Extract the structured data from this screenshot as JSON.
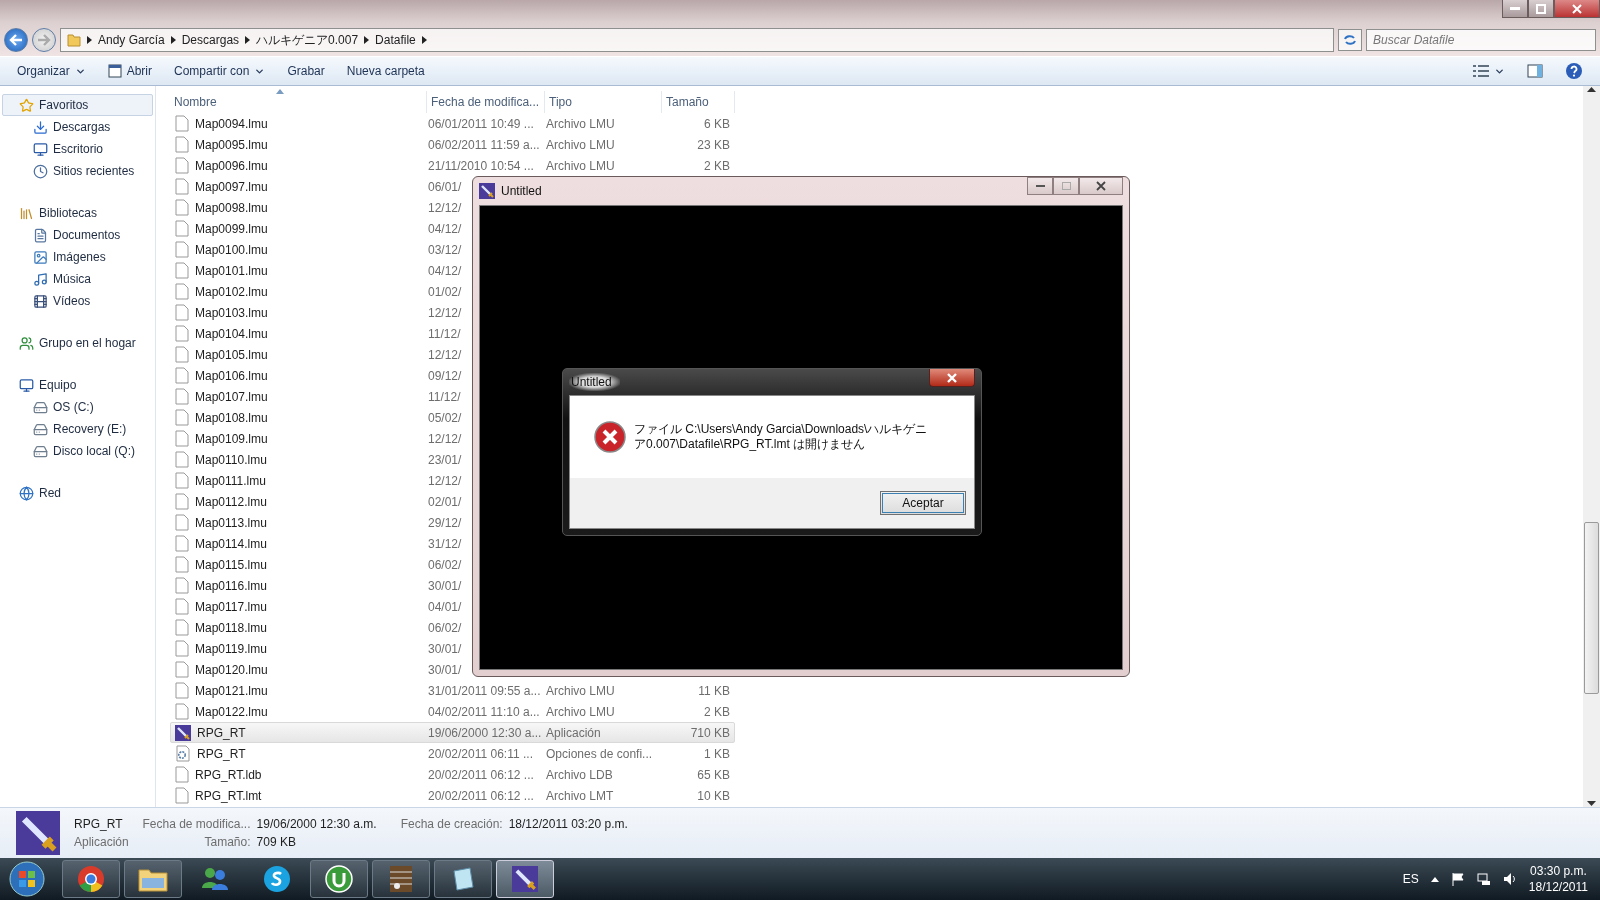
{
  "window": {
    "breadcrumb": [
      "Andy García",
      "Descargas",
      "ハルキゲニア0.007",
      "Datafile"
    ],
    "search": {
      "placeholder": "Buscar Datafile"
    }
  },
  "toolbar": [
    {
      "label": "Organizar",
      "has_menu": true,
      "kind": "text"
    },
    {
      "label": "Abrir",
      "has_menu": false,
      "kind": "open"
    },
    {
      "label": "Compartir con",
      "has_menu": true,
      "kind": "text"
    },
    {
      "label": "Grabar",
      "has_menu": false,
      "kind": "text"
    },
    {
      "label": "Nueva carpeta",
      "has_menu": false,
      "kind": "text"
    }
  ],
  "sidebar": [
    {
      "label": "Favoritos",
      "kind": "favorites",
      "selected": true,
      "children": [
        {
          "label": "Descargas",
          "kind": "downloads",
          "selected": false
        },
        {
          "label": "Escritorio",
          "kind": "desktop",
          "selected": false
        },
        {
          "label": "Sitios recientes",
          "kind": "recent",
          "selected": false
        }
      ]
    },
    {
      "label": "Bibliotecas",
      "kind": "libraries",
      "selected": false,
      "children": [
        {
          "label": "Documentos",
          "kind": "documents",
          "selected": false
        },
        {
          "label": "Imágenes",
          "kind": "pictures",
          "selected": false
        },
        {
          "label": "Música",
          "kind": "music",
          "selected": false
        },
        {
          "label": "Vídeos",
          "kind": "videos",
          "selected": false
        }
      ]
    },
    {
      "label": "Grupo en el hogar",
      "kind": "homegroup",
      "selected": false
    },
    {
      "label": "Equipo",
      "kind": "computer",
      "selected": false,
      "children": [
        {
          "label": "OS (C:)",
          "kind": "system-drive",
          "selected": false
        },
        {
          "label": "Recovery (E:)",
          "kind": "drive",
          "selected": false
        },
        {
          "label": "Disco local (Q:)",
          "kind": "drive",
          "selected": false
        }
      ]
    },
    {
      "label": "Red",
      "kind": "network",
      "selected": false
    }
  ],
  "table": {
    "columns": [
      {
        "label": "Nombre",
        "sorted": true
      },
      {
        "label": "Fecha de modifica..."
      },
      {
        "label": "Tipo"
      },
      {
        "label": "Tamaño"
      }
    ],
    "rows": [
      {
        "name": "Map0094.lmu",
        "kind": "file",
        "selected": false,
        "date": "06/01/2011 10:49 ...",
        "type": "Archivo LMU",
        "size": "6 KB"
      },
      {
        "name": "Map0095.lmu",
        "kind": "file",
        "selected": false,
        "date": "06/02/2011 11:59 a...",
        "type": "Archivo LMU",
        "size": "23 KB"
      },
      {
        "name": "Map0096.lmu",
        "kind": "file",
        "selected": false,
        "date": "21/11/2010 10:54 ...",
        "type": "Archivo LMU",
        "size": "2 KB"
      },
      {
        "name": "Map0097.lmu",
        "kind": "file",
        "selected": false,
        "date": "06/01/"
      },
      {
        "name": "Map0098.lmu",
        "kind": "file",
        "selected": false,
        "date": "12/12/"
      },
      {
        "name": "Map0099.lmu",
        "kind": "file",
        "selected": false,
        "date": "04/12/"
      },
      {
        "name": "Map0100.lmu",
        "kind": "file",
        "selected": false,
        "date": "03/12/"
      },
      {
        "name": "Map0101.lmu",
        "kind": "file",
        "selected": false,
        "date": "04/12/"
      },
      {
        "name": "Map0102.lmu",
        "kind": "file",
        "selected": false,
        "date": "01/02/"
      },
      {
        "name": "Map0103.lmu",
        "kind": "file",
        "selected": false,
        "date": "12/12/"
      },
      {
        "name": "Map0104.lmu",
        "kind": "file",
        "selected": false,
        "date": "11/12/"
      },
      {
        "name": "Map0105.lmu",
        "kind": "file",
        "selected": false,
        "date": "12/12/"
      },
      {
        "name": "Map0106.lmu",
        "kind": "file",
        "selected": false,
        "date": "09/12/"
      },
      {
        "name": "Map0107.lmu",
        "kind": "file",
        "selected": false,
        "date": "11/12/"
      },
      {
        "name": "Map0108.lmu",
        "kind": "file",
        "selected": false,
        "date": "05/02/"
      },
      {
        "name": "Map0109.lmu",
        "kind": "file",
        "selected": false,
        "date": "12/12/"
      },
      {
        "name": "Map0110.lmu",
        "kind": "file",
        "selected": false,
        "date": "23/01/"
      },
      {
        "name": "Map0111.lmu",
        "kind": "file",
        "selected": false,
        "date": "12/12/"
      },
      {
        "name": "Map0112.lmu",
        "kind": "file",
        "selected": false,
        "date": "02/01/"
      },
      {
        "name": "Map0113.lmu",
        "kind": "file",
        "selected": false,
        "date": "29/12/"
      },
      {
        "name": "Map0114.lmu",
        "kind": "file",
        "selected": false,
        "date": "31/12/"
      },
      {
        "name": "Map0115.lmu",
        "kind": "file",
        "selected": false,
        "date": "06/02/"
      },
      {
        "name": "Map0116.lmu",
        "kind": "file",
        "selected": false,
        "date": "30/01/"
      },
      {
        "name": "Map0117.lmu",
        "kind": "file",
        "selected": false,
        "date": "04/01/"
      },
      {
        "name": "Map0118.lmu",
        "kind": "file",
        "selected": false,
        "date": "06/02/"
      },
      {
        "name": "Map0119.lmu",
        "kind": "file",
        "selected": false,
        "date": "30/01/"
      },
      {
        "name": "Map0120.lmu",
        "kind": "file",
        "selected": false,
        "date": "30/01/"
      },
      {
        "name": "Map0121.lmu",
        "kind": "file",
        "selected": false,
        "date": "31/01/2011 09:55 a...",
        "type": "Archivo LMU",
        "size": "11 KB"
      },
      {
        "name": "Map0122.lmu",
        "kind": "file",
        "selected": false,
        "date": "04/02/2011 11:10 a...",
        "type": "Archivo LMU",
        "size": "2 KB"
      },
      {
        "name": "RPG_RT",
        "kind": "app",
        "selected": true,
        "date": "19/06/2000 12:30 a...",
        "type": "Aplicación",
        "size": "710 KB"
      },
      {
        "name": "RPG_RT",
        "kind": "config",
        "selected": false,
        "date": "20/02/2011 06:11 ...",
        "type": "Opciones de confi...",
        "size": "1 KB"
      },
      {
        "name": "RPG_RT.ldb",
        "kind": "file",
        "selected": false,
        "date": "20/02/2011 06:12 ...",
        "type": "Archivo LDB",
        "size": "65 KB"
      },
      {
        "name": "RPG_RT.lmt",
        "kind": "file",
        "selected": false,
        "date": "20/02/2011 06:12 ...",
        "type": "Archivo LMT",
        "size": "10 KB"
      }
    ]
  },
  "details": {
    "name": "RPG_RT",
    "type": "Aplicación",
    "fields": [
      {
        "label": "Fecha de modifica...",
        "value": "19/06/2000 12:30 a.m."
      },
      {
        "label": "Tamaño:",
        "value": "709 KB"
      },
      {
        "label": "Fecha de creación:",
        "value": "18/12/2011 03:20 p.m."
      }
    ]
  },
  "game_window": {
    "title": "Untitled"
  },
  "dialog": {
    "title": "Untitled",
    "message": "ファイル C:\\Users\\Andy Garcia\\Downloads\\ハルキゲニア0.007\\Datafile\\RPG_RT.lmt は開けません",
    "button": "Aceptar"
  },
  "taskbar": {
    "apps": [
      {
        "kind": "browser",
        "running": true,
        "selected": false
      },
      {
        "kind": "folder",
        "running": true,
        "selected": false
      },
      {
        "kind": "messenger",
        "running": false,
        "selected": false
      },
      {
        "kind": "chat",
        "running": false,
        "selected": false
      },
      {
        "kind": "torrent",
        "running": true,
        "selected": false
      },
      {
        "kind": "media",
        "running": true,
        "selected": false
      },
      {
        "kind": "notepad",
        "running": true,
        "selected": false
      },
      {
        "kind": "game",
        "running": true,
        "selected": true
      }
    ],
    "language": "ES",
    "time": "03:30 p.m.",
    "date": "18/12/2011"
  }
}
